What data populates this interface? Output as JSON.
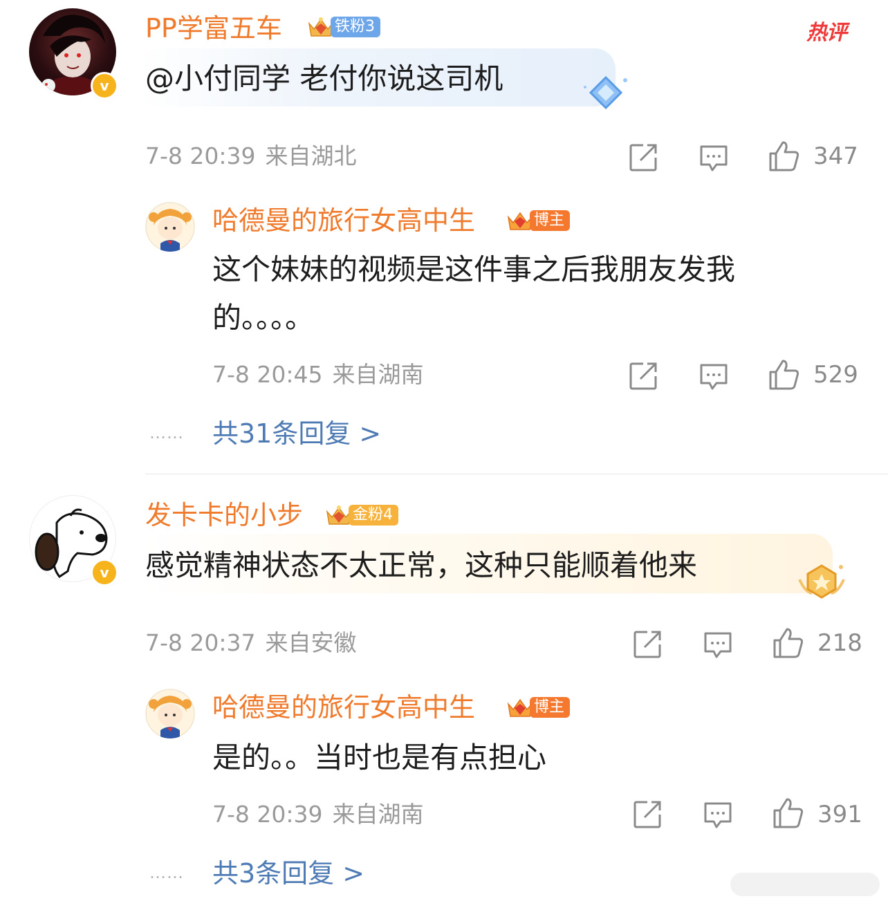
{
  "hot_label": "热评",
  "comments": [
    {
      "username": "PP学富五车",
      "fan_badge": {
        "level": "6",
        "text": "铁粉3"
      },
      "text": "@小付同学 老付你说这司机",
      "time": "7-8 20:39",
      "location": "来自湖北",
      "likes": "347",
      "reply": {
        "username": "哈德曼的旅行女高中生",
        "badge": {
          "level": "7",
          "text": "博主"
        },
        "text_lines": [
          "这个妹妹的视频是这件事之后我朋友发我",
          "的。。。。"
        ],
        "time": "7-8 20:45",
        "location": "来自湖南",
        "likes": "529"
      },
      "more_replies": "共31条回复 >"
    },
    {
      "username": "发卡卡的小步",
      "fan_badge": {
        "level": "5",
        "text": "金粉4"
      },
      "text": "感觉精神状态不太正常，这种只能顺着他来",
      "time": "7-8 20:37",
      "location": "来自安徽",
      "likes": "218",
      "reply": {
        "username": "哈德曼的旅行女高中生",
        "badge": {
          "level": "7",
          "text": "博主"
        },
        "text_lines": [
          "是的。。当时也是有点担心"
        ],
        "time": "7-8 20:39",
        "location": "来自湖南",
        "likes": "391"
      },
      "more_replies": "共3条回复 >"
    }
  ],
  "verified_mark": "v",
  "dots": "……",
  "colors": {
    "username": "#f07a2c",
    "link": "#4f7bb5",
    "meta": "#9a9a9a",
    "hot": "#ee3a3a",
    "verified": "#f6b31c"
  },
  "icons": [
    "share-icon",
    "comment-icon",
    "like-icon",
    "crown-icon",
    "diamond-icon",
    "star-medal-icon"
  ]
}
